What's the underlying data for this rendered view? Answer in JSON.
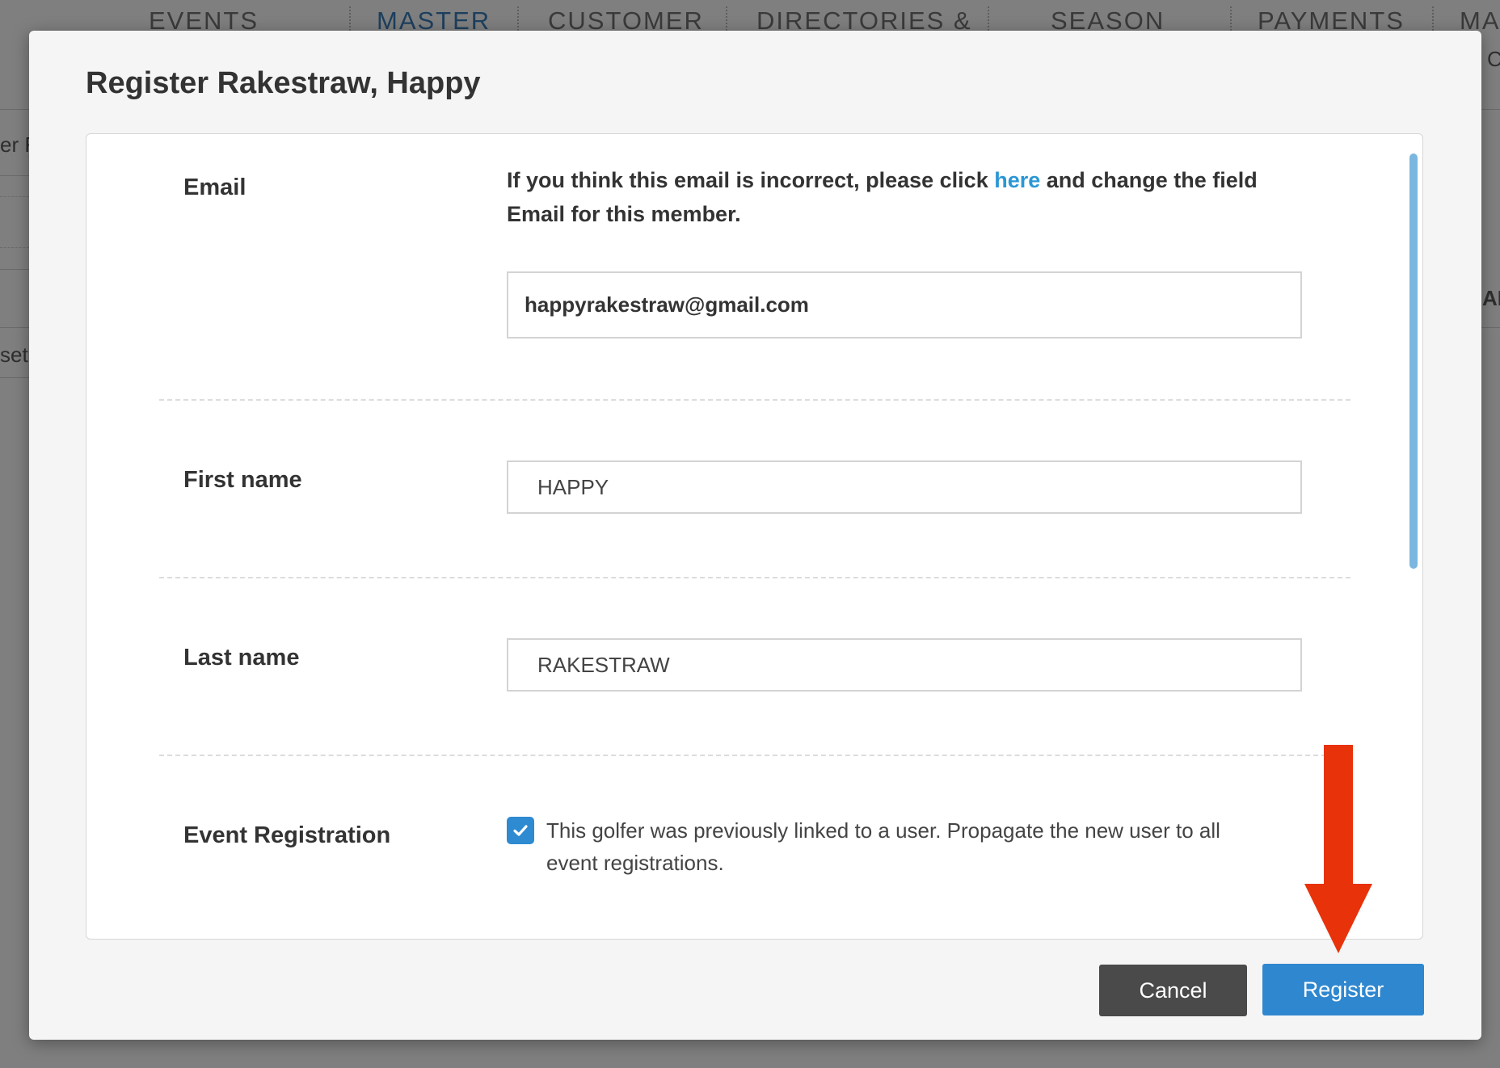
{
  "background": {
    "nav_tabs": [
      "EVENTS",
      "MASTER",
      "CUSTOMER",
      "DIRECTORIES &",
      "SEASON",
      "PAYMENTS",
      "MA"
    ],
    "fragments": [
      "er F",
      "set",
      "C",
      "AF"
    ]
  },
  "modal": {
    "title": "Register Rakestraw, Happy",
    "email": {
      "label": "Email",
      "hint_before": "If you think this email is incorrect, please click ",
      "hint_link": "here",
      "hint_after": " and change the field Email for this member.",
      "value": "happyrakestraw@gmail.com"
    },
    "first_name": {
      "label": "First name",
      "value": "HAPPY"
    },
    "last_name": {
      "label": "Last name",
      "value": "RAKESTRAW"
    },
    "event_registration": {
      "label": "Event Registration",
      "checked": true,
      "text": "This golfer was previously linked to a user. Propagate the new user to all event registrations."
    },
    "buttons": {
      "cancel": "Cancel",
      "register": "Register"
    }
  },
  "colors": {
    "accent": "#2f87cf",
    "link": "#2a97d4",
    "annotation_arrow": "#e8320a",
    "cancel": "#4a4a4a"
  },
  "icons": {
    "checkbox": "check-icon",
    "annotation": "down-arrow-annotation"
  }
}
